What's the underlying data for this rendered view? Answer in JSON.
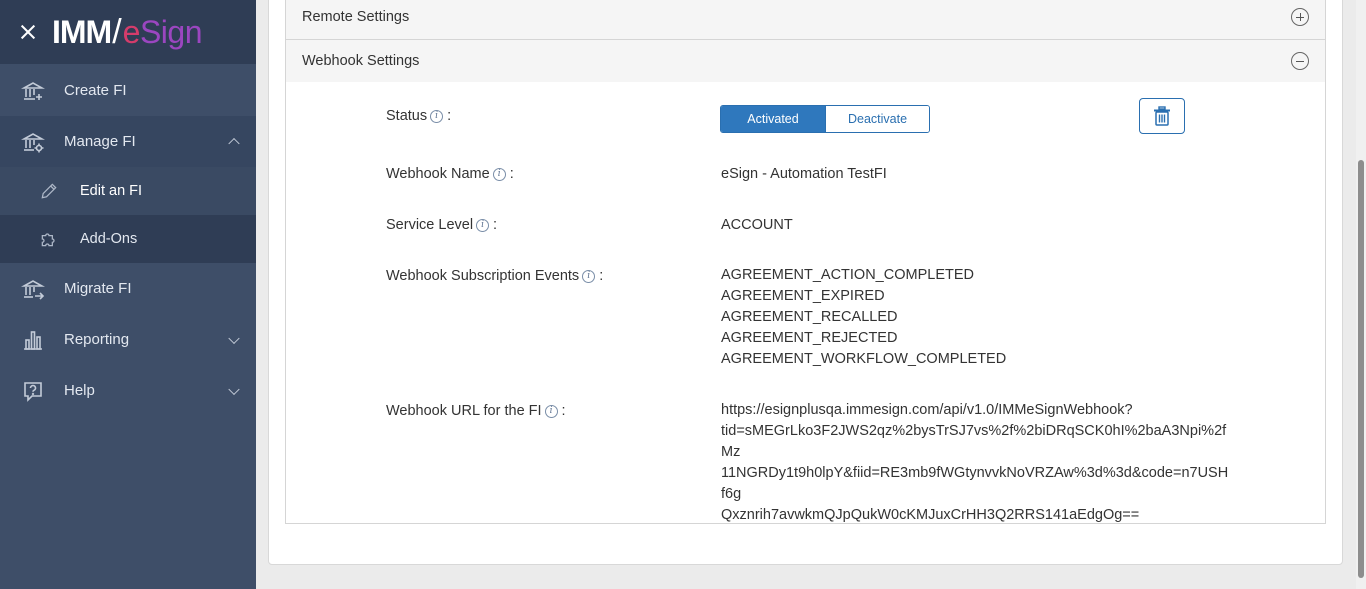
{
  "brand": {
    "imm": "IMM",
    "slash": "/",
    "esign_e": "e",
    "esign_rest": "Sign"
  },
  "sidebar": {
    "items": [
      {
        "label": "Create FI"
      },
      {
        "label": "Manage FI"
      },
      {
        "label": "Edit an FI"
      },
      {
        "label": "Add-Ons"
      },
      {
        "label": "Migrate FI"
      },
      {
        "label": "Reporting"
      },
      {
        "label": "Help"
      }
    ]
  },
  "panels": {
    "remote": {
      "title": "Remote Settings"
    },
    "webhook": {
      "title": "Webhook Settings"
    }
  },
  "webhook": {
    "status_label": "Status",
    "info_glyph": "i",
    "colon": ":",
    "activated_label": "Activated",
    "deactivate_label": "Deactivate",
    "name_label": "Webhook Name",
    "name_value": "eSign - Automation TestFI",
    "service_label": "Service Level",
    "service_value": "ACCOUNT",
    "events_label": "Webhook Subscription Events",
    "events": [
      "AGREEMENT_ACTION_COMPLETED",
      "AGREEMENT_EXPIRED",
      "AGREEMENT_RECALLED",
      "AGREEMENT_REJECTED",
      "AGREEMENT_WORKFLOW_COMPLETED"
    ],
    "url_label": "Webhook URL for the FI",
    "url_value": "https://esignplusqa.immesign.com/api/v1.0/IMMeSignWebhook?\ntid=sMEGrLko3F2JWS2qz%2bysTrSJ7vs%2f%2biDRqSCK0hI%2baA3Npi%2fMz\n11NGRDy1t9h0lpY&fiid=RE3mb9fWGtynvvkNoVRZAw%3d%3d&code=n7USHf6g\nQxznrih7avwkmQJpQukW0cKMJuxCrHH3Q2RRS141aEdgOg=="
  },
  "colors": {
    "sidebar_bg": "#3e4e68",
    "accent_blue": "#2f78bd",
    "brand_pink": "#d43c6b",
    "brand_purple": "#9b46c0"
  }
}
